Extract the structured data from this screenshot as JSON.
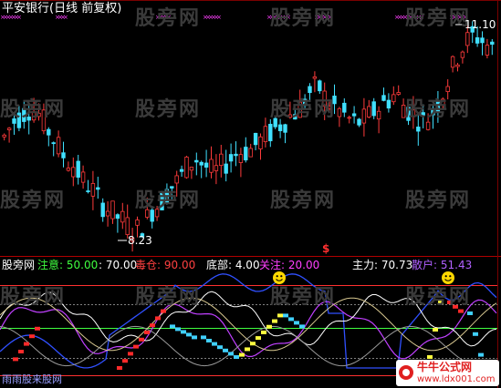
{
  "header": {
    "title": "平安银行(日线 前复权)"
  },
  "watermark": "股旁网",
  "price_panel": {
    "high_label": "11.10",
    "low_label": "8.23",
    "signal_mark": "$",
    "colors": {
      "up": "#ff3b3b",
      "down": "#40e0ff",
      "marker": "#ff40ff",
      "label": "#ffffff"
    }
  },
  "indicator_bar": {
    "name": "股旁网",
    "items": [
      {
        "label": "注意: 50.00",
        "color": "#40ff40"
      },
      {
        "label": ": 70.00",
        "color": "#ffffff"
      },
      {
        "label": "毒仓: 90.00",
        "color": "#ff4040"
      },
      {
        "label": "底部: 4.00",
        "color": "#ffffff"
      },
      {
        "label": "关注: 20.00",
        "color": "#ff40ff"
      },
      {
        "label": "主力: 70.73",
        "color": "#ffffff"
      },
      {
        "label": "散户: 51.43",
        "color": "#b060ff"
      }
    ]
  },
  "footer": {
    "left_text": "雨雨股来股网",
    "brand_name": "牛牛公式网",
    "brand_url": "www.ldx001.com"
  },
  "chart_data": [
    {
      "type": "candlestick",
      "title": "平安银行(日线 前复权)",
      "annotations": [
        {
          "text": "11.10",
          "kind": "highest"
        },
        {
          "text": "8.23",
          "kind": "lowest"
        }
      ],
      "approx_close_series": [
        9.6,
        9.8,
        9.9,
        10.0,
        9.9,
        9.7,
        9.5,
        9.3,
        9.2,
        9.0,
        8.9,
        8.7,
        8.6,
        8.5,
        8.4,
        8.3,
        8.4,
        8.6,
        8.7,
        8.9,
        9.0,
        9.2,
        9.3,
        9.2,
        9.1,
        9.2,
        9.3,
        9.4,
        9.4,
        9.5,
        9.6,
        9.7,
        9.8,
        9.9,
        10.0,
        10.2,
        10.3,
        10.1,
        10.0,
        9.9,
        9.8,
        9.8,
        9.9,
        10.0,
        10.1,
        10.2,
        10.0,
        9.9,
        9.8,
        9.9,
        10.1,
        10.4,
        10.7,
        10.9,
        11.0,
        10.9,
        10.8
      ]
    },
    {
      "type": "line",
      "title": "股旁网",
      "reference_lines": {
        "注意": 50.0,
        "70": 70.0,
        "毒仓": 90.0,
        "底部": 4.0,
        "关注": 20.0
      },
      "series": [
        {
          "name": "主力",
          "last": 70.73
        },
        {
          "name": "散户",
          "last": 51.43
        }
      ]
    }
  ]
}
